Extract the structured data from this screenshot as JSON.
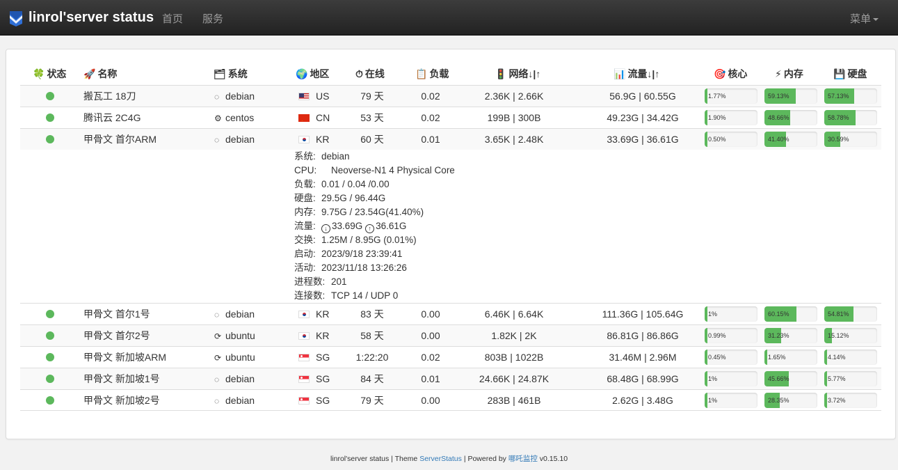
{
  "navbar": {
    "brand": "linrol'server status",
    "links": [
      "首页",
      "服务"
    ],
    "menu": "菜单"
  },
  "table": {
    "headers": [
      {
        "icon": "🍀",
        "label": "状态"
      },
      {
        "icon": "🚀",
        "label": "名称"
      },
      {
        "icon": "🗂",
        "label": "系统"
      },
      {
        "icon": "🌍",
        "label": "地区"
      },
      {
        "icon": "⏱",
        "label": "在线"
      },
      {
        "icon": "📋",
        "label": "负载"
      },
      {
        "icon": "🚦",
        "label": "网络↓|↑"
      },
      {
        "icon": "📊",
        "label": "流量↓|↑"
      },
      {
        "icon": "🎯",
        "label": "核心"
      },
      {
        "icon": "⚡",
        "label": "内存"
      },
      {
        "icon": "💾",
        "label": "硬盘"
      }
    ],
    "rows": [
      {
        "name": "搬瓦工 18刀",
        "os": "debian",
        "os_icon": "debian-icon",
        "flag": "us",
        "region": "US",
        "uptime": "79 天",
        "load": "0.02",
        "network": "2.36K | 2.66K",
        "traffic": "56.9G | 60.55G",
        "cpu": "1.77%",
        "cpu_pct": 1.77,
        "mem": "59.13%",
        "mem_pct": 59.13,
        "disk": "57.13%",
        "disk_pct": 57.13
      },
      {
        "name": "腾讯云 2C4G",
        "os": "centos",
        "os_icon": "centos-icon",
        "flag": "cn",
        "region": "CN",
        "uptime": "53 天",
        "load": "0.02",
        "network": "199B | 300B",
        "traffic": "49.23G | 34.42G",
        "cpu": "1.90%",
        "cpu_pct": 1.9,
        "mem": "48.66%",
        "mem_pct": 48.66,
        "disk": "58.78%",
        "disk_pct": 58.78
      },
      {
        "name": "甲骨文 首尔ARM",
        "os": "debian",
        "os_icon": "debian-icon",
        "flag": "kr",
        "region": "KR",
        "uptime": "60 天",
        "load": "0.01",
        "network": "3.65K | 2.48K",
        "traffic": "33.69G | 36.61G",
        "cpu": "0.50%",
        "cpu_pct": 0.5,
        "mem": "41.40%",
        "mem_pct": 41.4,
        "disk": "30.59%",
        "disk_pct": 30.59
      },
      {
        "name": "甲骨文 首尔1号",
        "os": "debian",
        "os_icon": "debian-icon",
        "flag": "kr",
        "region": "KR",
        "uptime": "83 天",
        "load": "0.00",
        "network": "6.46K | 6.64K",
        "traffic": "111.36G | 105.64G",
        "cpu": "1%",
        "cpu_pct": 1,
        "mem": "60.15%",
        "mem_pct": 60.15,
        "disk": "54.81%",
        "disk_pct": 54.81
      },
      {
        "name": "甲骨文 首尔2号",
        "os": "ubuntu",
        "os_icon": "ubuntu-icon",
        "flag": "kr",
        "region": "KR",
        "uptime": "58 天",
        "load": "0.00",
        "network": "1.82K | 2K",
        "traffic": "86.81G | 86.86G",
        "cpu": "0.99%",
        "cpu_pct": 0.99,
        "mem": "31.23%",
        "mem_pct": 31.23,
        "disk": "15.12%",
        "disk_pct": 15.12
      },
      {
        "name": "甲骨文 新加坡ARM",
        "os": "ubuntu",
        "os_icon": "ubuntu-icon",
        "flag": "sg",
        "region": "SG",
        "uptime": "1:22:20",
        "load": "0.02",
        "network": "803B | 1022B",
        "traffic": "31.46M | 2.96M",
        "cpu": "0.45%",
        "cpu_pct": 0.45,
        "mem": "1.65%",
        "mem_pct": 1.65,
        "disk": "4.14%",
        "disk_pct": 4.14
      },
      {
        "name": "甲骨文 新加坡1号",
        "os": "debian",
        "os_icon": "debian-icon",
        "flag": "sg",
        "region": "SG",
        "uptime": "84 天",
        "load": "0.01",
        "network": "24.66K | 24.87K",
        "traffic": "68.48G | 68.99G",
        "cpu": "1%",
        "cpu_pct": 1,
        "mem": "45.66%",
        "mem_pct": 45.66,
        "disk": "5.77%",
        "disk_pct": 5.77
      },
      {
        "name": "甲骨文 新加坡2号",
        "os": "debian",
        "os_icon": "debian-icon",
        "flag": "sg",
        "region": "SG",
        "uptime": "79 天",
        "load": "0.00",
        "network": "283B | 461B",
        "traffic": "2.62G | 3.48G",
        "cpu": "1%",
        "cpu_pct": 1,
        "mem": "28.35%",
        "mem_pct": 28.35,
        "disk": "3.72%",
        "disk_pct": 3.72
      }
    ],
    "expanded_detail": [
      {
        "k": "系统:",
        "v": "debian"
      },
      {
        "k": "CPU:",
        "v": "Neoverse-N1 4 Physical Core"
      },
      {
        "k": "负载:",
        "v": "0.01 / 0.04 /0.00"
      },
      {
        "k": "硬盘:",
        "v": "29.5G / 96.44G"
      },
      {
        "k": "内存:",
        "v": "9.75G / 23.54G(41.40%)"
      },
      {
        "k": "流量:",
        "v": "",
        "down": "33.69G",
        "up": "36.61G"
      },
      {
        "k": "交换:",
        "v": "1.25M / 8.95G (0.01%)"
      },
      {
        "k": "启动:",
        "v": "2023/9/18 23:39:41"
      },
      {
        "k": "活动:",
        "v": "2023/11/18 13:26:26"
      },
      {
        "k": "进程数:",
        "v": "201"
      },
      {
        "k": "连接数:",
        "v": "TCP 14 / UDP 0"
      }
    ]
  },
  "footer": {
    "prefix": "linrol'server status | Theme ",
    "theme_link": "ServerStatus",
    "middle": " | Powered by ",
    "powered_link": "哪吒监控",
    "version": " v0.15.10"
  },
  "colors": {
    "status_online": "#5cb85c",
    "bar_fill": "#5cb85c",
    "navbar": "#222222",
    "brand_icon": "#2f6fd6"
  }
}
